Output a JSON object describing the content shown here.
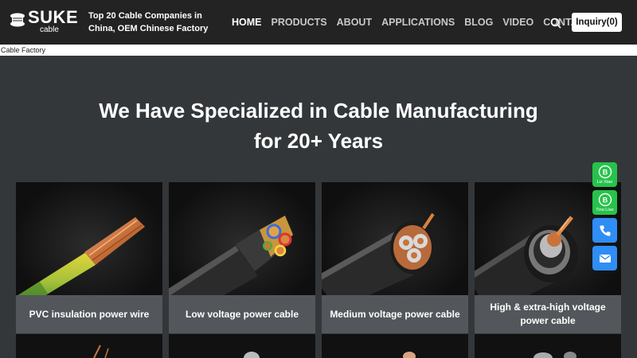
{
  "header": {
    "logo_text": "SUKE",
    "logo_sub": "cable",
    "tagline": "Top 20 Cable Companies in China, OEM Chinese Factory",
    "nav": [
      {
        "label": "HOME",
        "active": true
      },
      {
        "label": "PRODUCTS",
        "active": false
      },
      {
        "label": "ABOUT",
        "active": false
      },
      {
        "label": "APPLICATIONS",
        "active": false
      },
      {
        "label": "BLOG",
        "active": false
      },
      {
        "label": "VIDEO",
        "active": false
      },
      {
        "label": "CONTACT",
        "active": false
      }
    ],
    "search_icon": "search-icon",
    "inquiry_label": "Inquiry(0)"
  },
  "breadcrumb": {
    "text": "Cable Factory"
  },
  "hero": {
    "line1": "We Have Specialized in Cable Manufacturing",
    "line2": "for 20+ Years"
  },
  "products": [
    {
      "caption": "PVC insulation power wire"
    },
    {
      "caption": "Low voltage power cable"
    },
    {
      "caption": "Medium voltage power cable"
    },
    {
      "caption": "High & extra-high voltage power cable"
    }
  ],
  "floating_contacts": [
    {
      "icon": "whatsapp-icon",
      "name": "Liz Xiao"
    },
    {
      "icon": "whatsapp-icon",
      "name": "Tina Liao"
    },
    {
      "icon": "phone-icon"
    },
    {
      "icon": "mail-icon"
    }
  ],
  "colors": {
    "header_bg": "#232323",
    "page_bg": "#34373a",
    "caption_bg": "#53575b",
    "whatsapp": "#27c24c",
    "contact_blue": "#2f8df5"
  }
}
